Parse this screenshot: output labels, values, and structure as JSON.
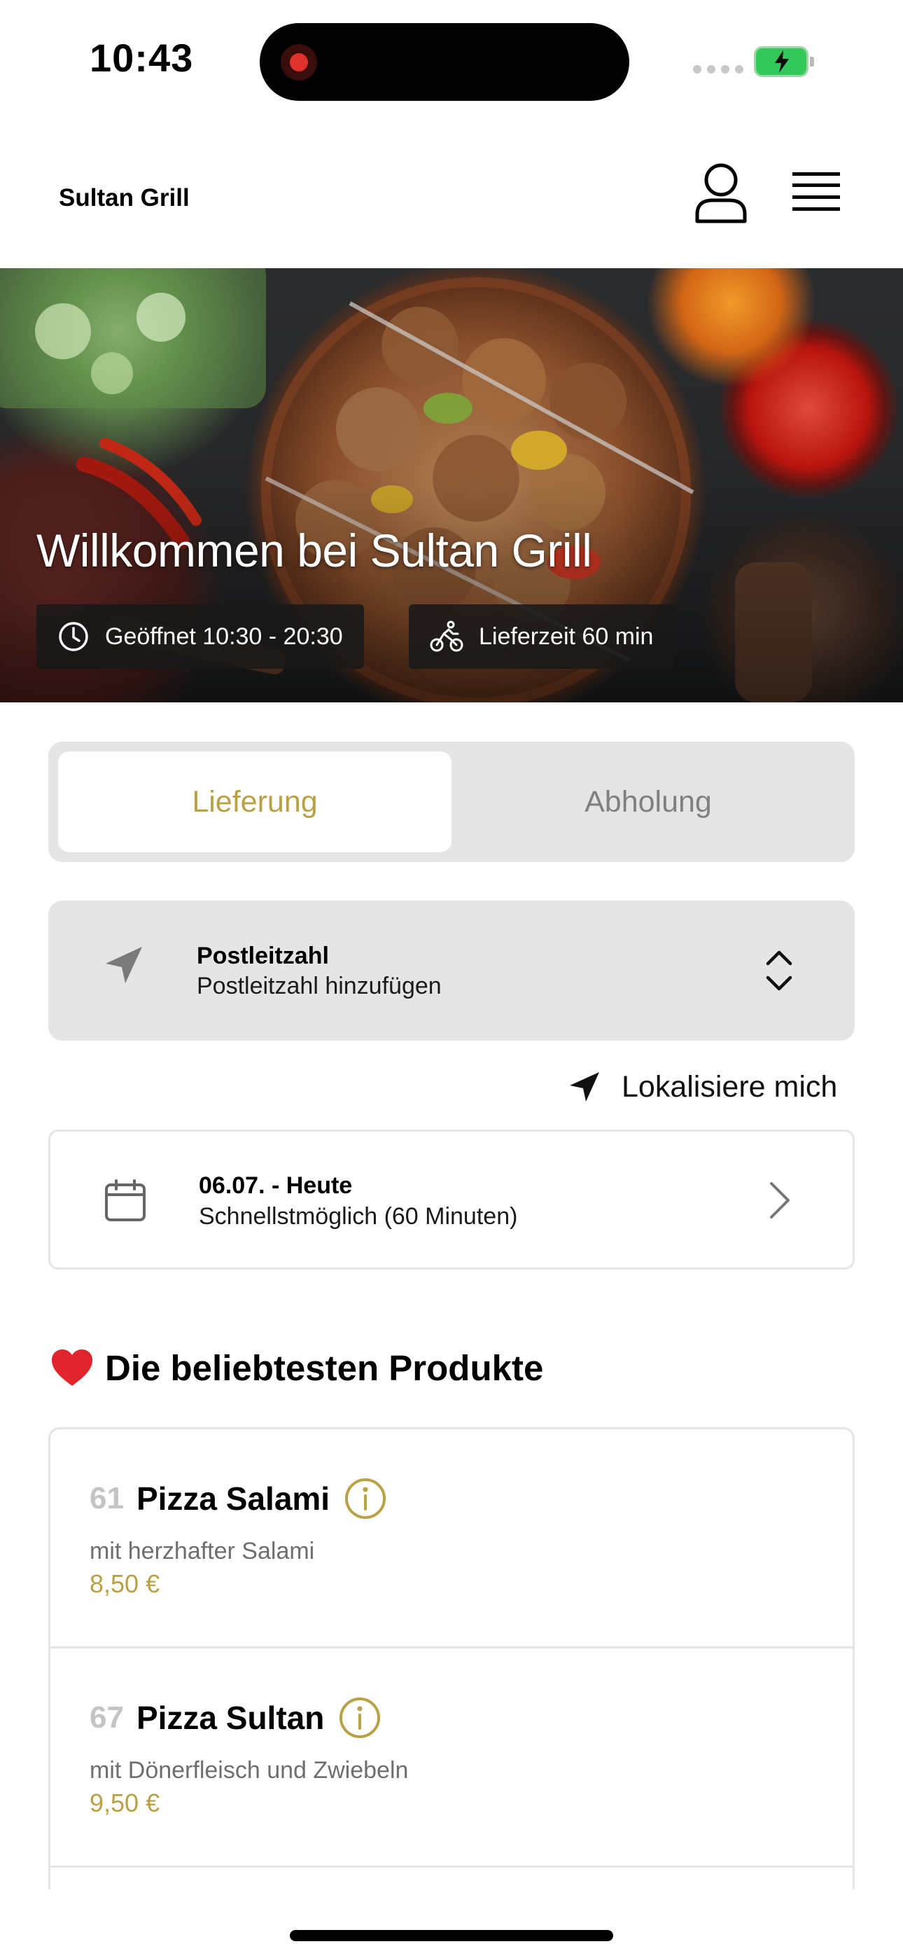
{
  "status_bar": {
    "time": "10:43"
  },
  "header": {
    "brand": "Sultan Grill",
    "profile_icon": "person-icon",
    "menu_icon": "hamburger-menu-icon"
  },
  "hero": {
    "title": "Willkommen bei Sultan Grill",
    "hours_label": "Geöffnet 10:30 - 20:30",
    "delivery_time_label": "Lieferzeit 60 min",
    "hours_icon": "clock-icon",
    "delivery_icon": "bicycle-rider-icon"
  },
  "order_mode": {
    "options": [
      "Lieferung",
      "Abholung"
    ],
    "selected": "Lieferung"
  },
  "postcode": {
    "label": "Postleitzahl",
    "placeholder": "Postleitzahl hinzufügen",
    "icon": "location-arrow-icon"
  },
  "locate": {
    "label": "Lokalisiere mich"
  },
  "delivery_date": {
    "title": "06.07. - Heute",
    "subtitle": "Schnellstmöglich (60 Minuten)",
    "icon": "calendar-icon"
  },
  "popular": {
    "title": "Die beliebtesten Produkte",
    "icon": "heart-icon",
    "products": [
      {
        "number": "61",
        "name": "Pizza Salami",
        "description": "mit herzhafter Salami",
        "price": "8,50 €"
      },
      {
        "number": "67",
        "name": "Pizza Sultan",
        "description": "mit Dönerfleisch und Zwiebeln",
        "price": "9,50 €"
      }
    ]
  },
  "colors": {
    "accent_gold": "#b9a145",
    "panel_gray": "#e5e5e5",
    "muted_text": "#808080",
    "battery_green": "#34c759"
  }
}
